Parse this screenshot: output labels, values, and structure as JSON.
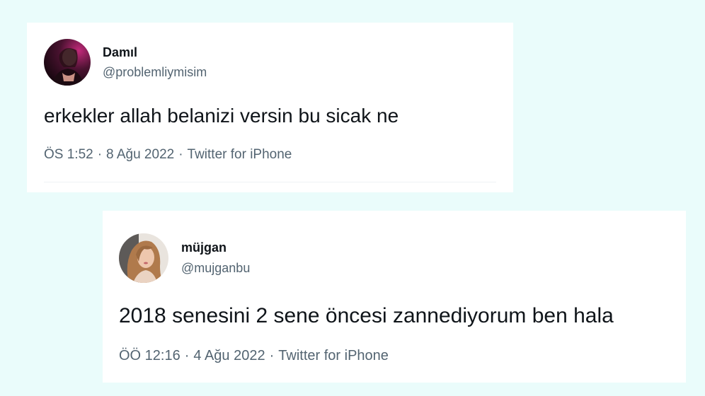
{
  "tweets": [
    {
      "display_name": "Damıl",
      "handle": "@problemliymisim",
      "text": "erkekler allah belanizi versin bu sicak ne",
      "time": "ÖS 1:52",
      "date": "8 Ağu 2022",
      "source": "Twitter for iPhone"
    },
    {
      "display_name": "müjgan",
      "handle": "@mujganbu",
      "text": "2018 senesini 2 sene öncesi zannediyorum ben hala",
      "time": "ÖÖ 12:16",
      "date": "4 Ağu 2022",
      "source": "Twitter for iPhone"
    }
  ],
  "meta_separator": "·",
  "colors": {
    "background": "#eafcfb",
    "card": "#ffffff",
    "text_primary": "#0f1419",
    "text_secondary": "#536471"
  }
}
